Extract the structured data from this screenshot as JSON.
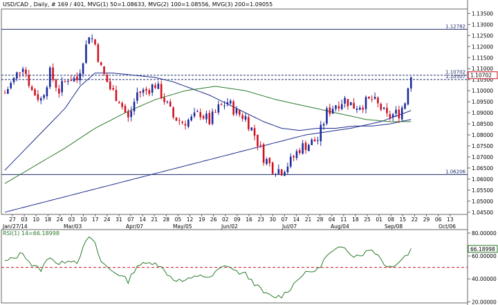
{
  "chart_data": [
    {
      "type": "candlestick",
      "title": "USD/CAD , Daily, # 169 / 401, MVG(1) 50=1.08633, MVG(2) 100=1.08556, MVG(3) 200=1.09055",
      "ylim": [
        1.044,
        1.137
      ],
      "yticks": [
        "1.04500",
        "1.05000",
        "1.05500",
        "1.06000",
        "1.06500",
        "1.07000",
        "1.07500",
        "1.08000",
        "1.08500",
        "1.09000",
        "1.09500",
        "1.10000",
        "1.10500",
        "1.11000",
        "1.11500",
        "1.12000",
        "1.12500",
        "1.13000",
        "1.13500"
      ],
      "x_day_labels": [
        "27",
        "03",
        "10",
        "18",
        "24",
        "03",
        "10",
        "17",
        "24",
        "31",
        "07",
        "14",
        "21",
        "28",
        "05",
        "12",
        "19",
        "26",
        "02",
        "09",
        "16",
        "23",
        "30",
        "07",
        "14",
        "21",
        "28",
        "04",
        "11",
        "18",
        "25",
        "01",
        "08",
        "15",
        "22",
        "29",
        "06",
        "13"
      ],
      "x_month_labels": [
        "Jan/27/14",
        "Mar/03",
        "Apr/07",
        "May/05",
        "Jun/02",
        "Jul/07",
        "Aug/04",
        "Sep/08",
        "Oct/06"
      ],
      "hlines": [
        {
          "label": "1.12782",
          "value": 1.12782,
          "style": "solid"
        },
        {
          "label": "1.06206",
          "value": 1.06206,
          "style": "solid"
        },
        {
          "label": "1.10702",
          "value": 1.10702,
          "style": "dashed"
        },
        {
          "label": "1.10507",
          "value": 1.10507,
          "style": "dashed"
        }
      ],
      "current_price": "1.10702",
      "current_price_value": 1.10702,
      "anchors": [
        [
          0,
          1.099
        ],
        [
          3,
          1.105
        ],
        [
          6,
          1.112
        ],
        [
          9,
          1.1
        ],
        [
          12,
          1.096
        ],
        [
          15,
          1.108
        ],
        [
          18,
          1.1
        ],
        [
          21,
          1.106
        ],
        [
          24,
          1.105
        ],
        [
          27,
          1.12
        ],
        [
          28,
          1.126
        ],
        [
          30,
          1.121
        ],
        [
          32,
          1.11
        ],
        [
          35,
          1.101
        ],
        [
          38,
          1.096
        ],
        [
          41,
          1.087
        ],
        [
          44,
          1.099
        ],
        [
          47,
          1.1
        ],
        [
          50,
          1.103
        ],
        [
          53,
          1.096
        ],
        [
          56,
          1.088
        ],
        [
          59,
          1.086
        ],
        [
          62,
          1.087
        ],
        [
          65,
          1.09
        ],
        [
          68,
          1.086
        ],
        [
          71,
          1.092
        ],
        [
          74,
          1.095
        ],
        [
          77,
          1.09
        ],
        [
          80,
          1.088
        ],
        [
          83,
          1.08
        ],
        [
          86,
          1.07
        ],
        [
          89,
          1.065
        ],
        [
          92,
          1.064
        ],
        [
          95,
          1.068
        ],
        [
          98,
          1.074
        ],
        [
          101,
          1.076
        ],
        [
          104,
          1.078
        ],
        [
          107,
          1.09
        ],
        [
          110,
          1.094
        ],
        [
          113,
          1.096
        ],
        [
          116,
          1.093
        ],
        [
          119,
          1.094
        ],
        [
          122,
          1.096
        ],
        [
          125,
          1.092
        ],
        [
          127,
          1.088
        ],
        [
          129,
          1.089
        ],
        [
          131,
          1.09
        ],
        [
          133,
          1.095
        ],
        [
          134,
          1.103
        ],
        [
          135,
          1.107
        ]
      ],
      "ma_series": [
        {
          "label": "MVG(1) 50",
          "color": "#1a2a8c",
          "pts": [
            [
              0,
              1.064
            ],
            [
              10,
              1.078
            ],
            [
              20,
              1.092
            ],
            [
              25,
              1.102
            ],
            [
              30,
              1.108
            ],
            [
              36,
              1.108
            ],
            [
              43,
              1.107
            ],
            [
              50,
              1.106
            ],
            [
              56,
              1.104
            ],
            [
              62,
              1.101
            ],
            [
              68,
              1.098
            ],
            [
              74,
              1.094
            ],
            [
              80,
              1.09
            ],
            [
              86,
              1.086
            ],
            [
              92,
              1.083
            ],
            [
              98,
              1.082
            ],
            [
              104,
              1.083
            ],
            [
              110,
              1.083
            ],
            [
              116,
              1.084
            ],
            [
              122,
              1.084
            ],
            [
              128,
              1.085
            ],
            [
              135,
              1.087
            ]
          ]
        },
        {
          "label": "MVG(2) 100",
          "color": "#2a7a2a",
          "pts": [
            [
              0,
              1.058
            ],
            [
              10,
              1.066
            ],
            [
              20,
              1.074
            ],
            [
              30,
              1.083
            ],
            [
              40,
              1.09
            ],
            [
              50,
              1.096
            ],
            [
              60,
              1.1
            ],
            [
              70,
              1.102
            ],
            [
              80,
              1.1
            ],
            [
              90,
              1.096
            ],
            [
              100,
              1.093
            ],
            [
              110,
              1.09
            ],
            [
              120,
              1.087
            ],
            [
              128,
              1.086
            ],
            [
              135,
              1.086
            ]
          ]
        },
        {
          "label": "MVG(3) 200",
          "color": "#1a2a8c",
          "pts": [
            [
              0,
              1.045
            ],
            [
              20,
              1.052
            ],
            [
              40,
              1.059
            ],
            [
              60,
              1.066
            ],
            [
              80,
              1.073
            ],
            [
              100,
              1.08
            ],
            [
              115,
              1.083
            ],
            [
              125,
              1.086
            ],
            [
              135,
              1.091
            ]
          ]
        }
      ]
    },
    {
      "type": "line",
      "title": "RSI(1) 14=66.18998",
      "ylim": [
        19,
        83
      ],
      "yticks": [
        "20.00000",
        "40.00000",
        "60.00000",
        "80.00000"
      ],
      "current_value_label": "66.18998",
      "current_value": 66.19,
      "reference_line": 50,
      "series": [
        {
          "values_anchor": [
            [
              0,
              55
            ],
            [
              3,
              58
            ],
            [
              6,
              63
            ],
            [
              9,
              52
            ],
            [
              12,
              48
            ],
            [
              15,
              60
            ],
            [
              18,
              52
            ],
            [
              21,
              57
            ],
            [
              24,
              55
            ],
            [
              27,
              72
            ],
            [
              28,
              77
            ],
            [
              30,
              70
            ],
            [
              32,
              55
            ],
            [
              35,
              48
            ],
            [
              38,
              44
            ],
            [
              41,
              38
            ],
            [
              44,
              52
            ],
            [
              47,
              53
            ],
            [
              50,
              55
            ],
            [
              53,
              47
            ],
            [
              56,
              40
            ],
            [
              59,
              38
            ],
            [
              62,
              40
            ],
            [
              65,
              44
            ],
            [
              68,
              40
            ],
            [
              71,
              48
            ],
            [
              74,
              52
            ],
            [
              77,
              46
            ],
            [
              80,
              44
            ],
            [
              83,
              36
            ],
            [
              86,
              28
            ],
            [
              89,
              24
            ],
            [
              92,
              25
            ],
            [
              95,
              32
            ],
            [
              98,
              42
            ],
            [
              101,
              46
            ],
            [
              104,
              48
            ],
            [
              107,
              60
            ],
            [
              110,
              65
            ],
            [
              113,
              68
            ],
            [
              116,
              60
            ],
            [
              119,
              62
            ],
            [
              122,
              66
            ],
            [
              125,
              58
            ],
            [
              127,
              50
            ],
            [
              129,
              52
            ],
            [
              131,
              55
            ],
            [
              133,
              60
            ],
            [
              134,
              62
            ],
            [
              135,
              66
            ]
          ]
        }
      ]
    }
  ]
}
